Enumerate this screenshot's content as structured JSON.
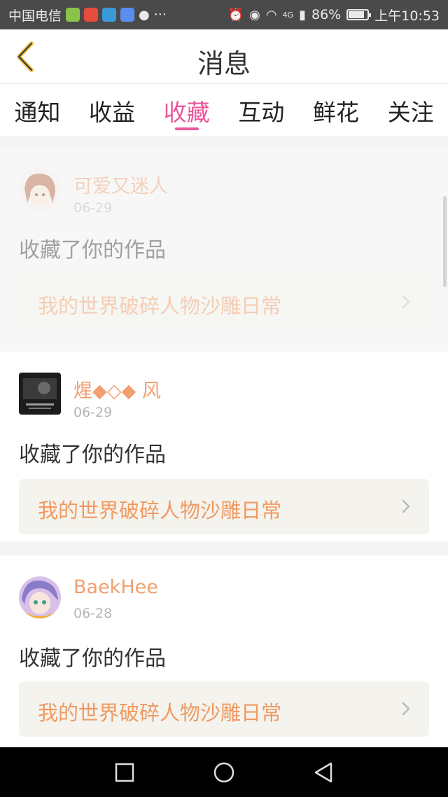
{
  "status_bar": {
    "carrier": "中国电信",
    "more": "···",
    "battery_percent": "86%",
    "battery_level": 0.86,
    "time": "上午10:53",
    "network": "4G"
  },
  "header": {
    "title": "消息"
  },
  "tabs": [
    {
      "label": "通知",
      "active": false
    },
    {
      "label": "收益",
      "active": false
    },
    {
      "label": "收藏",
      "active": true
    },
    {
      "label": "互动",
      "active": false
    },
    {
      "label": "鲜花",
      "active": false
    },
    {
      "label": "关注",
      "active": false
    }
  ],
  "items": [
    {
      "username": "可爱又迷人",
      "date": "06-29",
      "action": "收藏了你的作品",
      "work": "我的世界破碎人物沙雕日常"
    },
    {
      "username": "煋◆◇◆ 风",
      "date": "06-29",
      "action": "收藏了你的作品",
      "work": "我的世界破碎人物沙雕日常"
    },
    {
      "username": "BaekHee",
      "date": "06-28",
      "action": "收藏了你的作品",
      "work": "我的世界破碎人物沙雕日常"
    }
  ],
  "colors": {
    "accent": "#e8579a",
    "username": "#f0a070",
    "work_title": "#f09a62"
  }
}
